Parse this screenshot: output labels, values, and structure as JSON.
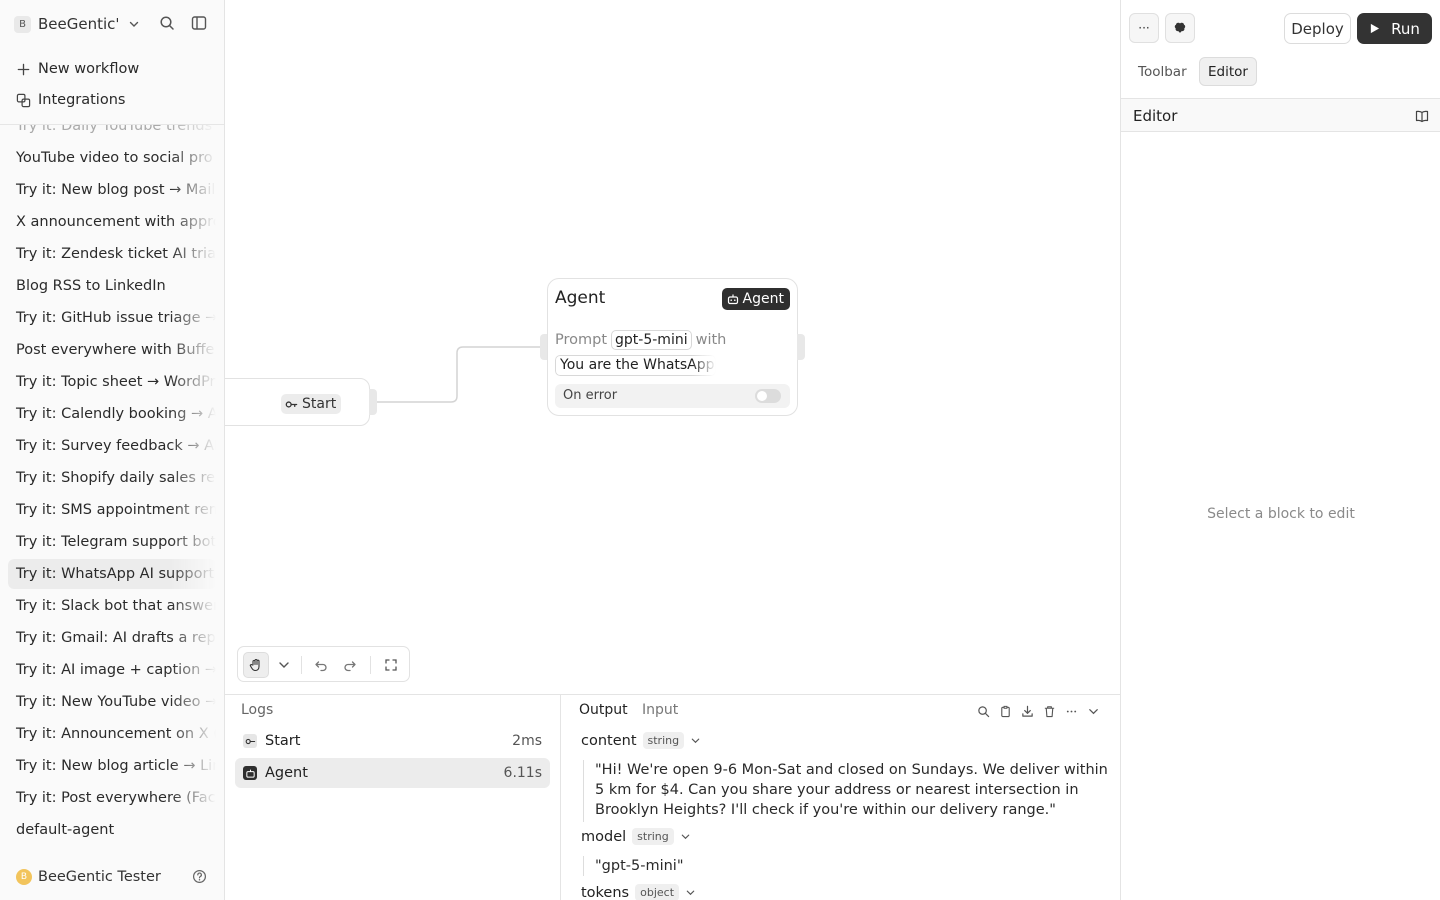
{
  "sidebar": {
    "workspace_badge": "B",
    "workspace_name": "BeeGentic's",
    "actions": {
      "new_workflow": "New workflow",
      "integrations": "Integrations"
    },
    "partial_item": "Try it: Daily YouTube trends",
    "workflows": [
      "YouTube video to social pro",
      "Try it: New blog post → Mailc",
      "X announcement with appro",
      "Try it: Zendesk ticket AI triag",
      "Blog RSS to LinkedIn",
      "Try it: GitHub issue triage → c",
      "Post everywhere with Buffer",
      "Try it: Topic sheet → WordPre",
      "Try it: Calendly booking → AI",
      "Try it: Survey feedback → AI s",
      "Try it: Shopify daily sales rep",
      "Try it: SMS appointment rem",
      "Try it: Telegram support bot",
      "Try it: WhatsApp AI support r",
      "Try it: Slack bot that answers",
      "Try it: Gmail: AI drafts a reply",
      "Try it: AI image + caption → In",
      "Try it: New YouTube video → |",
      "Try it: Announcement on X (T",
      "Try it: New blog article → Link",
      "Try it: Post everywhere (Face",
      "default-agent"
    ],
    "active_index": 13,
    "user_initial": "B",
    "user_name": "BeeGentic Tester"
  },
  "canvas": {
    "start_node": {
      "label": "Start"
    },
    "agent_node": {
      "title": "Agent",
      "badge": "Agent",
      "prompt_label": "Prompt",
      "model": "gpt-5-mini",
      "with_label": "with",
      "system_prompt": "You are the WhatsApp AI",
      "on_error_label": "On error",
      "on_error_enabled": false
    }
  },
  "logs": {
    "title": "Logs",
    "rows": [
      {
        "name": "Start",
        "time": "2ms"
      },
      {
        "name": "Agent",
        "time": "6.11s"
      }
    ]
  },
  "output": {
    "tabs": [
      "Output",
      "Input"
    ],
    "active_tab": "Output",
    "fields": {
      "content": {
        "key": "content",
        "type": "string",
        "value": "\"Hi! We're open 9-6 Mon-Sat and closed on Sundays. We deliver within 5 km for $4. Can you share your address or nearest intersection in Brooklyn Heights? I'll check if you're within our delivery range.\""
      },
      "model": {
        "key": "model",
        "type": "string",
        "value": "\"gpt-5-mini\""
      },
      "tokens": {
        "key": "tokens",
        "type": "object"
      }
    }
  },
  "right_panel": {
    "more_label": "···",
    "deploy_label": "Deploy",
    "run_label": "Run",
    "tabs": [
      "Toolbar",
      "Editor"
    ],
    "active_tab": "Editor",
    "editor_title": "Editor",
    "empty_hint": "Select a block to edit"
  },
  "colors": {
    "run_button": "#333333",
    "active_row": "#ececec",
    "user_avatar": "#f2c45c",
    "agent_badge": "#2f2f2f"
  }
}
